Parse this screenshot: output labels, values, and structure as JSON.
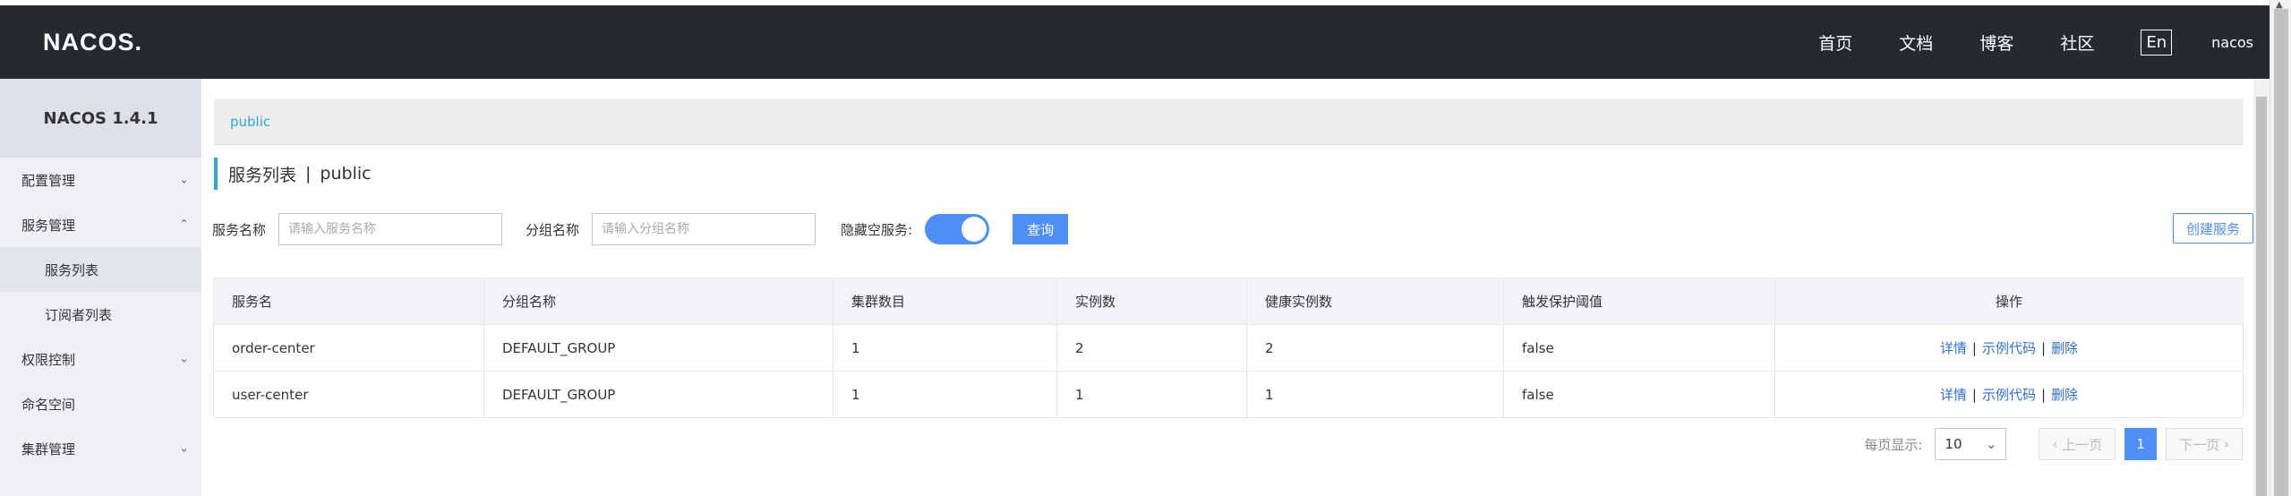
{
  "header": {
    "logo": "NACOS.",
    "nav": [
      "首页",
      "文档",
      "博客",
      "社区"
    ],
    "lang": "En",
    "user": "nacos"
  },
  "sidebar": {
    "version": "NACOS 1.4.1",
    "items": [
      {
        "label": "配置管理",
        "chevron": "chevron-down"
      },
      {
        "label": "服务管理",
        "chevron": "chevron-up"
      },
      {
        "label": "服务列表",
        "sub": true,
        "active": true
      },
      {
        "label": "订阅者列表",
        "sub": true
      },
      {
        "label": "权限控制",
        "chevron": "chevron-down"
      },
      {
        "label": "命名空间"
      },
      {
        "label": "集群管理",
        "chevron": "chevron-down"
      }
    ]
  },
  "breadcrumb": "public",
  "page_title": {
    "main": "服务列表",
    "sep": "|",
    "namespace": "public"
  },
  "filters": {
    "service_label": "服务名称",
    "service_placeholder": "请输入服务名称",
    "group_label": "分组名称",
    "group_placeholder": "请输入分组名称",
    "hide_empty_label": "隐藏空服务:",
    "hide_empty_on": true,
    "query_button": "查询",
    "create_button": "创建服务"
  },
  "table": {
    "headers": [
      "服务名",
      "分组名称",
      "集群数目",
      "实例数",
      "健康实例数",
      "触发保护阈值",
      "操作"
    ],
    "rows": [
      [
        "order-center",
        "DEFAULT_GROUP",
        "1",
        "2",
        "2",
        "false"
      ],
      [
        "user-center",
        "DEFAULT_GROUP",
        "1",
        "1",
        "1",
        "false"
      ]
    ],
    "ops": [
      "详情",
      "示例代码",
      "删除"
    ]
  },
  "pager": {
    "per_page_label": "每页显示:",
    "per_page_value": "10",
    "prev": "上一页",
    "current": "1",
    "next": "下一页"
  },
  "colors": {
    "topbar": "#252a2f",
    "primary": "#4e8ef7",
    "link": "#2f6fd6",
    "accent": "#2fa5d6"
  }
}
